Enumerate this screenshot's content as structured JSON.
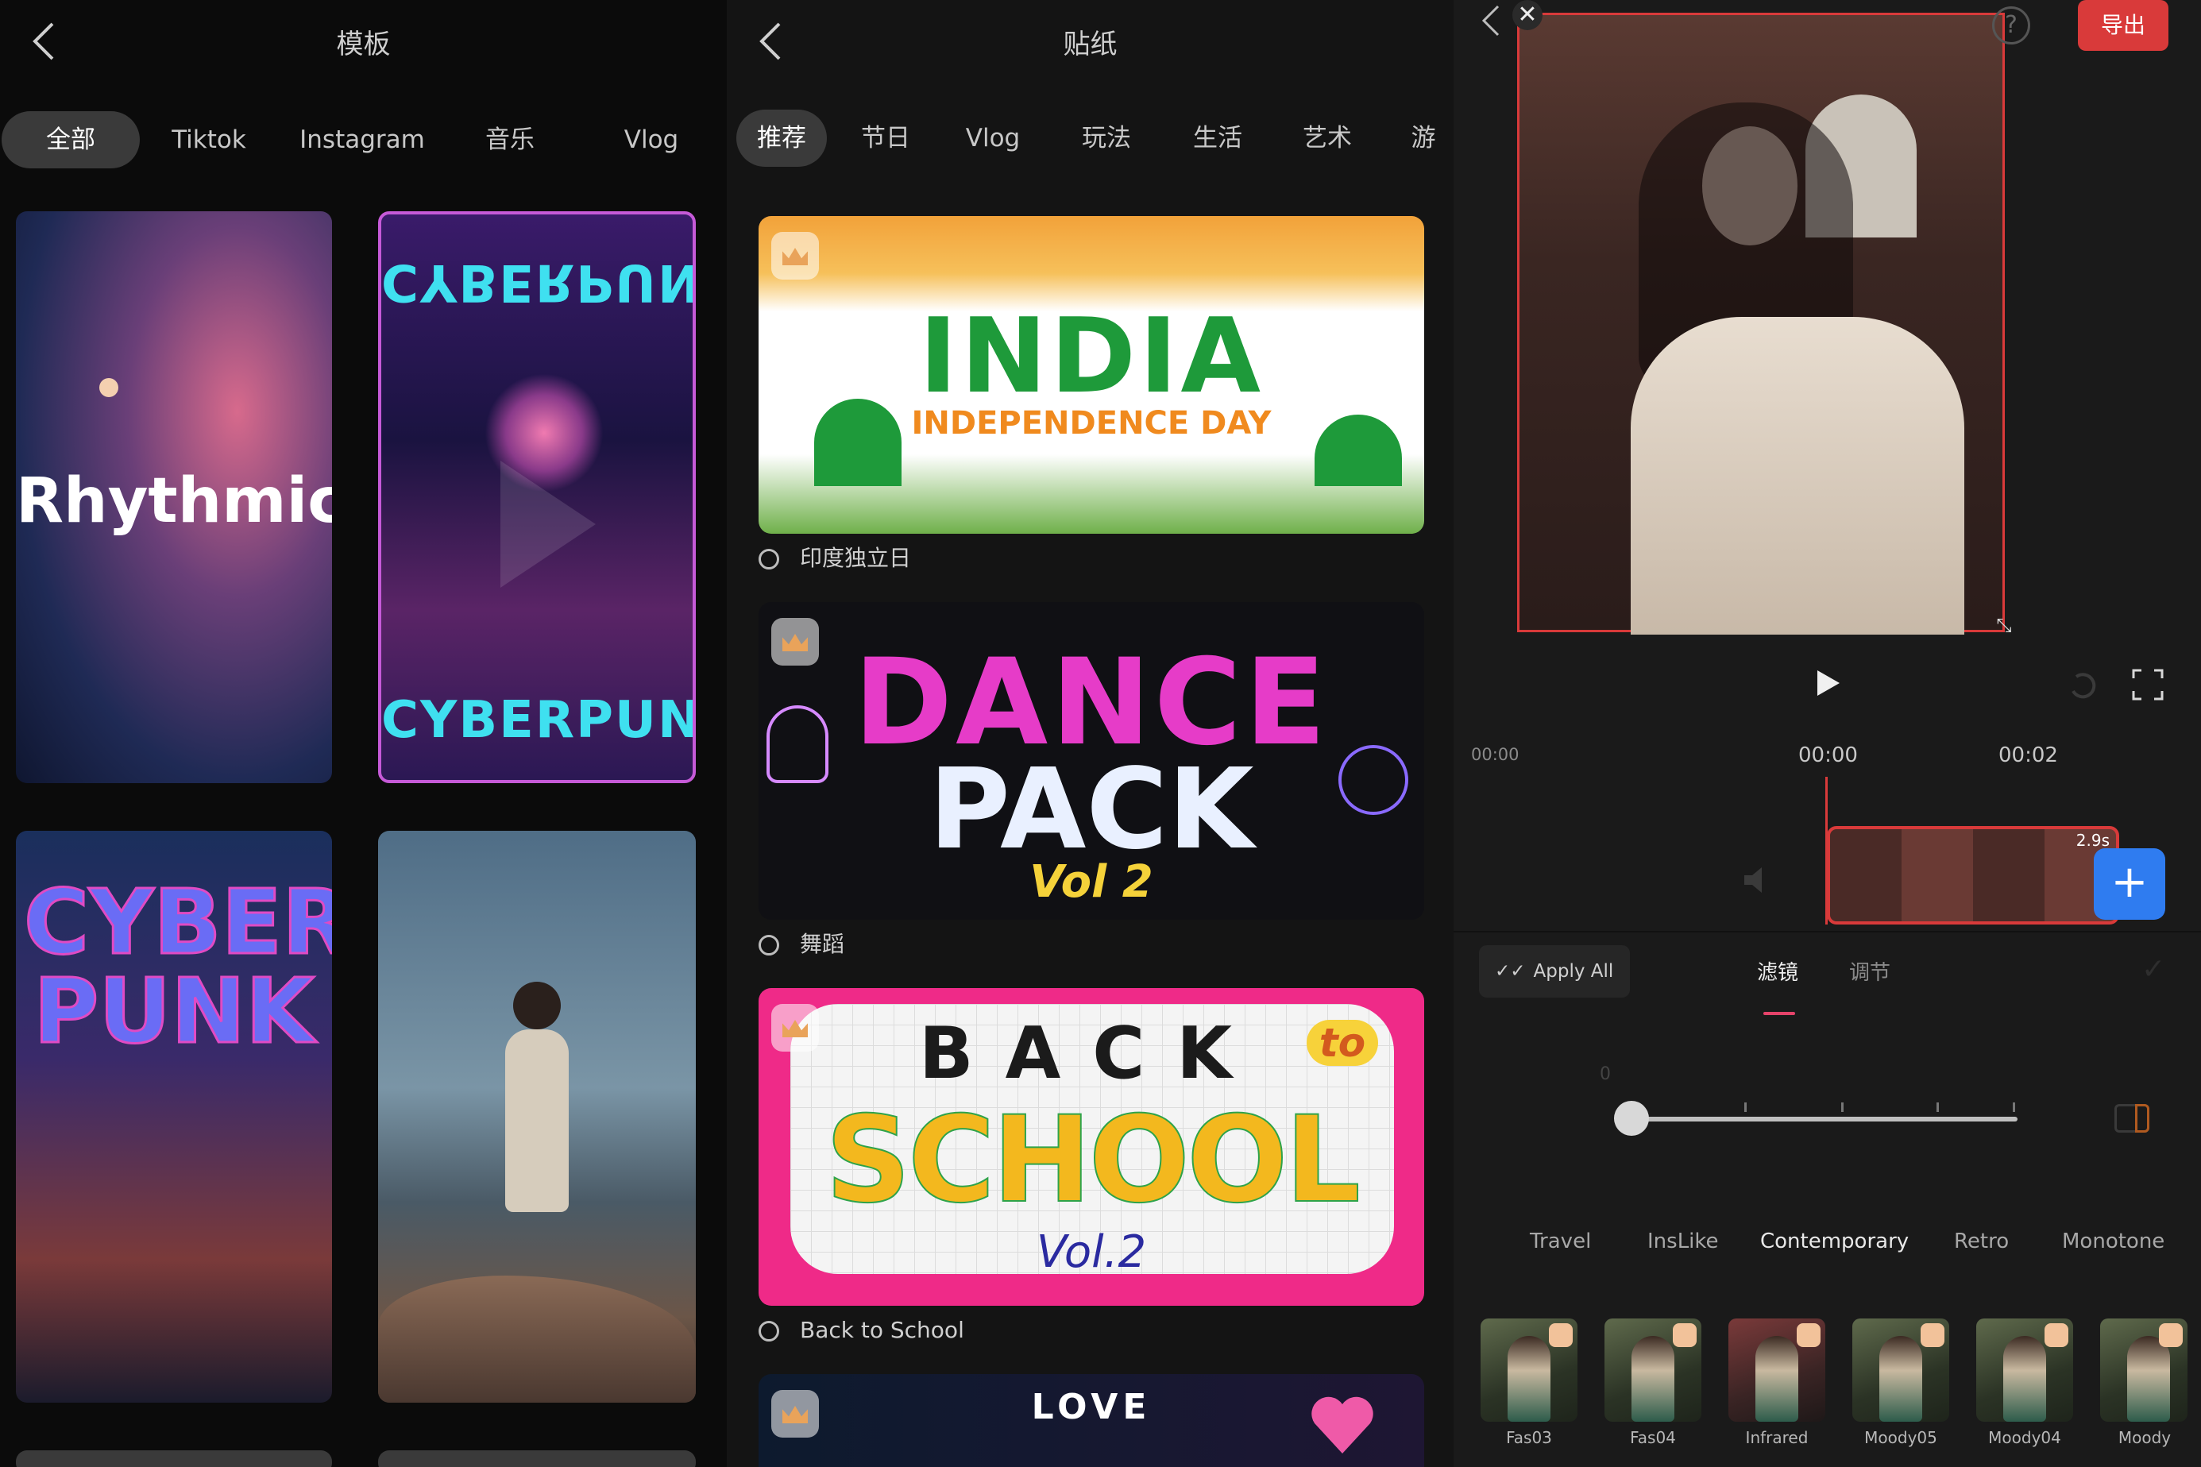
{
  "templates": {
    "title": "模板",
    "tabs": [
      "全部",
      "Tiktok",
      "Instagram",
      "音乐",
      "Vlog"
    ],
    "selected_tab": "全部",
    "cards": [
      {
        "text": "Rhythmic"
      },
      {
        "text_top": "CYBERPUNK",
        "text_bottom": "CYBERPUNK"
      },
      {
        "text": "CYBER PUNK"
      },
      {
        "text": ""
      }
    ]
  },
  "stickers": {
    "title": "贴纸",
    "tabs": [
      "推荐",
      "节日",
      "Vlog",
      "玩法",
      "生活",
      "艺术",
      "游"
    ],
    "selected_tab": "推荐",
    "packs": [
      {
        "art_title": "INDIA",
        "art_sub": "INDEPENDENCE DAY",
        "caption": "印度独立日"
      },
      {
        "art_title": "DANCE",
        "art_sub": "PACK",
        "art_vol": "Vol 2",
        "caption": "舞蹈"
      },
      {
        "art_title": "BACK",
        "art_word2": "to",
        "art_sub": "SCHOOL",
        "art_vol": "Vol.2",
        "caption": "Back to School"
      },
      {
        "art_title": "LOVE",
        "caption": ""
      }
    ]
  },
  "editor": {
    "export_label": "导出",
    "help_icon": "question-icon",
    "time_start": "00:00",
    "time_current": "00:00",
    "time_mark": "00:02",
    "clip_duration": "2.9s",
    "apply_all_label": "Apply All",
    "panel_tabs": [
      "滤镜",
      "调节"
    ],
    "selected_panel_tab": "滤镜",
    "slider_value_label": "0",
    "slider_level": 0,
    "filter_categories": [
      "Travel",
      "InsLike",
      "Contemporary",
      "Retro",
      "Monotone"
    ],
    "selected_category": "Contemporary",
    "filters": [
      "Fas03",
      "Fas04",
      "Infrared",
      "Moody05",
      "Moody04",
      "Moody"
    ]
  },
  "colors": {
    "accent_red": "#d93a3a",
    "add_blue": "#2f7cf0",
    "selected_tab_bg": "#3a3a3a"
  }
}
